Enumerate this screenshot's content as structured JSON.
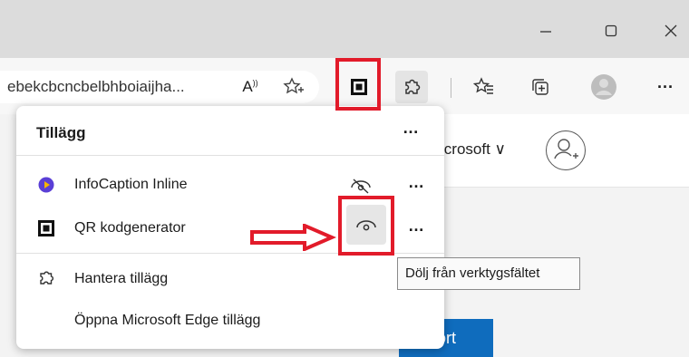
{
  "window": {
    "minimize_icon": "minimize-icon",
    "maximize_icon": "maximize-icon",
    "close_icon": "close-icon"
  },
  "toolbar": {
    "address_text": "ebekcbcncbelbhboiaijha...",
    "icons": [
      "read-aloud-icon",
      "add-favorite-icon",
      "qr-code-extension-icon",
      "extensions-puzzle-icon",
      "favorites-icon",
      "collections-icon",
      "profile-avatar-icon",
      "more-icon"
    ],
    "read_aloud_glyph": "Â"
  },
  "page": {
    "microsoft_text": "icrosoft ∨",
    "button_text": "ort"
  },
  "panel": {
    "title": "Tillägg",
    "more": "…",
    "items": [
      {
        "label": "InfoCaption Inline",
        "more": "…"
      },
      {
        "label": "QR kodgenerator",
        "more": "…"
      }
    ],
    "manage_label": "Hantera tillägg",
    "open_store_label": "Öppna Microsoft Edge tillägg"
  },
  "tooltip": {
    "text": "Dölj från verktygsfältet"
  },
  "colors": {
    "highlight": "#e21b2a",
    "accent": "#0f6cbd"
  }
}
